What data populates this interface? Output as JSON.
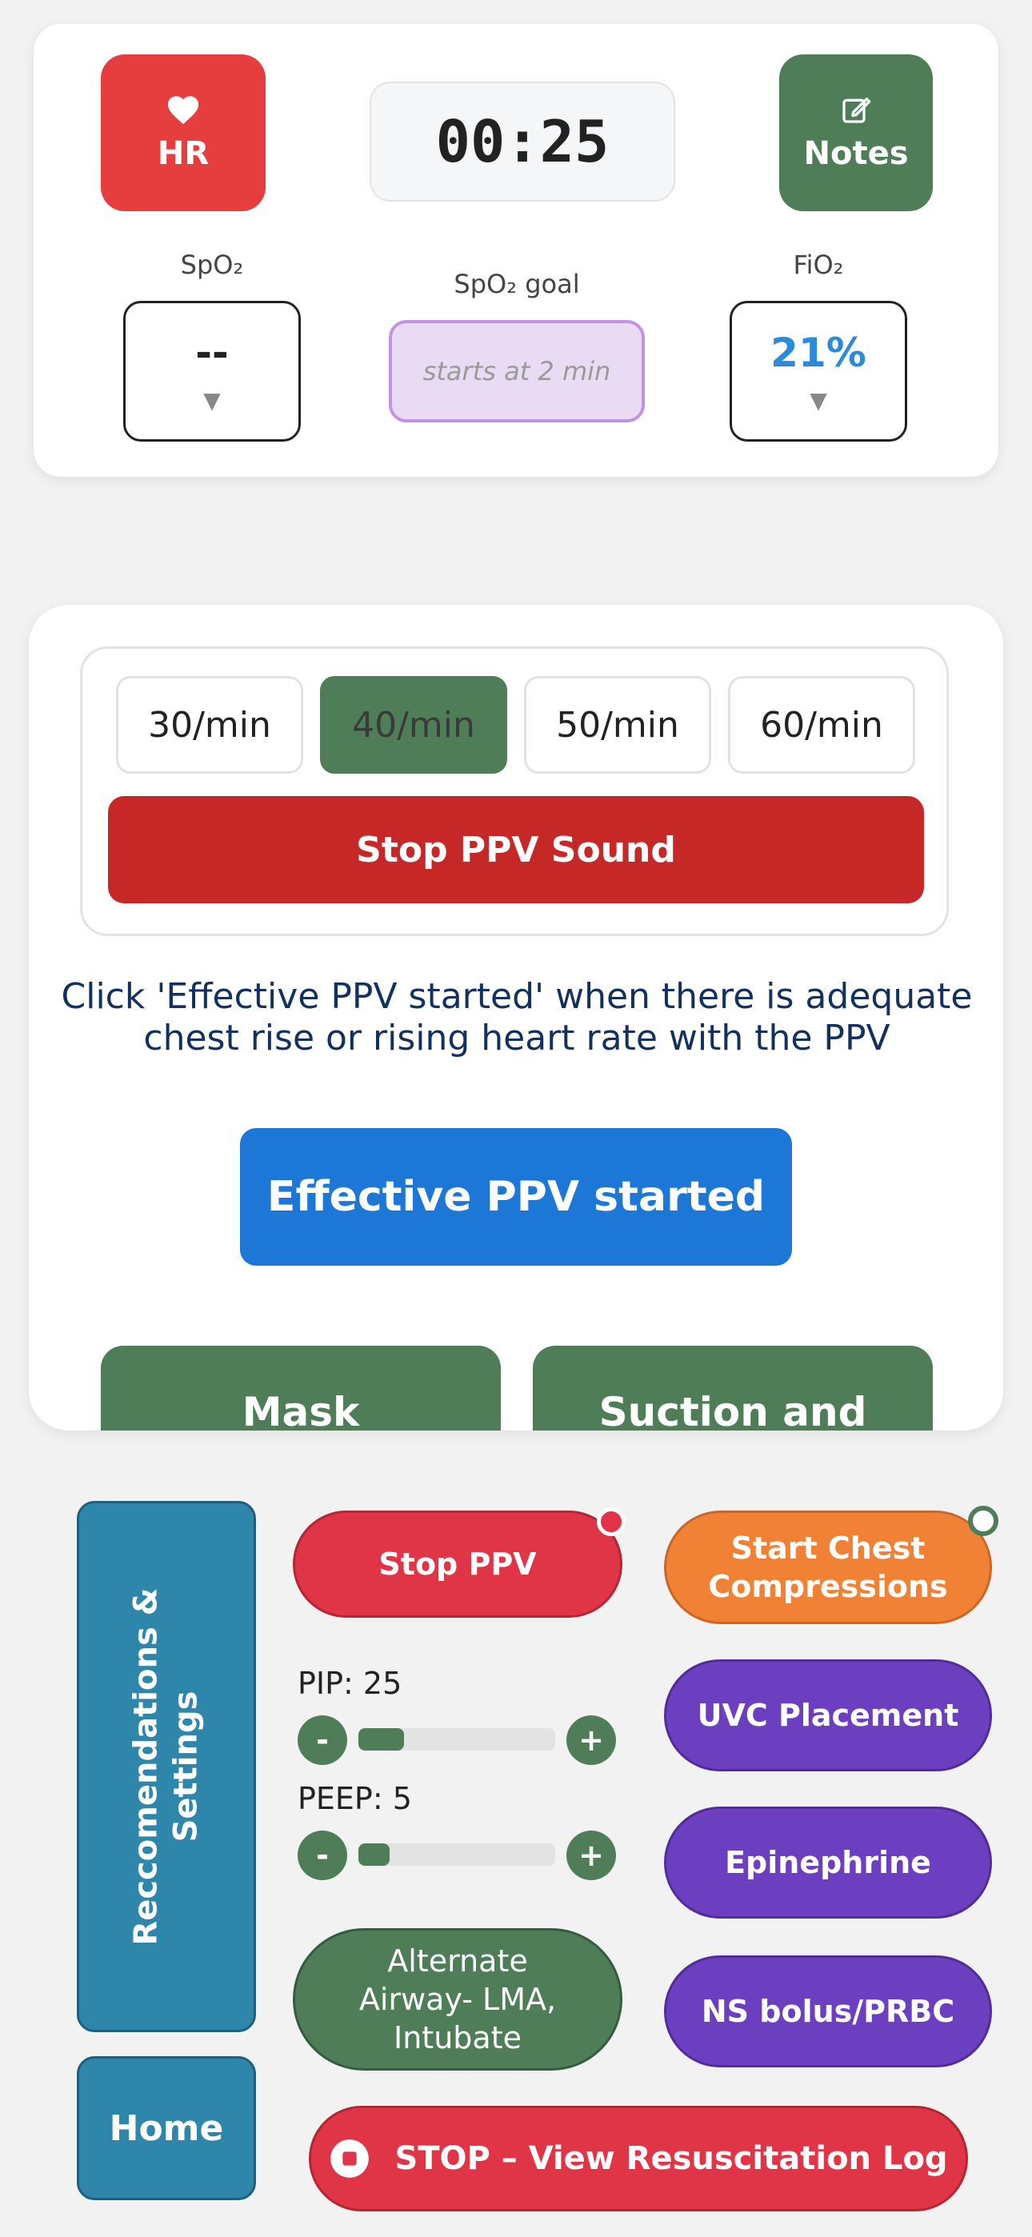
{
  "header": {
    "hr_label": "HR",
    "timer": "00:25",
    "notes_label": "Notes",
    "spo2_label": "SpO₂",
    "spo2_value": "--",
    "spo2_goal_label": "SpO₂ goal",
    "spo2_goal_value": "starts at 2 min",
    "fio2_label": "FiO₂",
    "fio2_value": "21%",
    "dropdown_arrow": "▼"
  },
  "ppv": {
    "rates": [
      "30/min",
      "40/min",
      "50/min",
      "60/min"
    ],
    "active_rate": "40/min",
    "stop_sound_label": "Stop PPV Sound",
    "instruction": "Click 'Effective PPV started' when there is adequate chest rise or rising heart rate with the PPV",
    "effective_label": "Effective PPV started",
    "mask_label": "Mask",
    "suction_label": "Suction and"
  },
  "controls": {
    "reco_line1": "Reccomendations &",
    "reco_line2": "Settings",
    "home_label": "Home",
    "stop_ppv_label": "Stop PPV",
    "start_cc_label": "Start Chest Compressions",
    "uvc_label": "UVC Placement",
    "epi_label": "Epinephrine",
    "ns_label": "NS bolus/PRBC",
    "alt_airway_label": "Alternate Airway- LMA, Intubate",
    "pip_label": "PIP: 25",
    "pip_value": 25,
    "pip_level": 0.23,
    "peep_label": "PEEP: 5",
    "peep_value": 5,
    "peep_level": 0.16,
    "minus": "-",
    "plus": "+",
    "stop_log_label": "STOP – View Resuscitation Log"
  },
  "colors": {
    "red": "#e63d3f",
    "green": "#4e7d58",
    "blue": "#1d77d6",
    "purple": "#6b3fc0",
    "orange": "#f18235",
    "teal": "#2e86ab"
  }
}
